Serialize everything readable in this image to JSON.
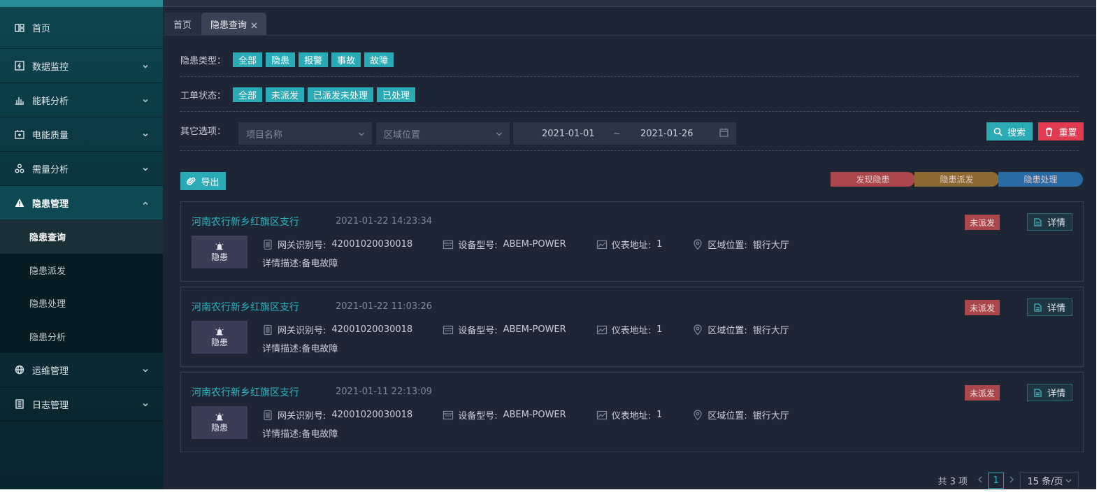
{
  "sidebar": {
    "items": [
      {
        "label": "首页",
        "icon": "dashboard-icon"
      },
      {
        "label": "数据监控",
        "icon": "monitor-icon"
      },
      {
        "label": "能耗分析",
        "icon": "bar-chart-icon"
      },
      {
        "label": "电能质量",
        "icon": "battery-icon"
      },
      {
        "label": "需量分析",
        "icon": "nodes-icon"
      },
      {
        "label": "隐患管理",
        "icon": "warning-icon"
      },
      {
        "label": "运维管理",
        "icon": "globe-icon"
      },
      {
        "label": "日志管理",
        "icon": "log-icon"
      }
    ],
    "submenu": [
      "隐患查询",
      "隐患派发",
      "隐患处理",
      "隐患分析"
    ]
  },
  "tabs": [
    {
      "label": "首页"
    },
    {
      "label": "隐患查询"
    }
  ],
  "filters": {
    "type_label": "隐患类型：",
    "type_options": [
      "全部",
      "隐患",
      "报警",
      "事故",
      "故障"
    ],
    "status_label": "工单状态：",
    "status_options": [
      "全部",
      "未派发",
      "已派发未处理",
      "已处理"
    ],
    "other_label": "其它选项：",
    "project_placeholder": "项目名称",
    "area_placeholder": "区域位置",
    "date_start": "2021-01-01",
    "date_sep": "~",
    "date_end": "2021-01-26"
  },
  "actions": {
    "search": "搜索",
    "reset": "重置",
    "export": "导出"
  },
  "steps": [
    "发现隐患",
    "隐患派发",
    "隐患处理"
  ],
  "step_colors": [
    "#a9474d",
    "#8c6a32",
    "#2a6aa5"
  ],
  "cards": [
    {
      "title": "河南农行新乡红旗区支行",
      "time": "2021-01-22 14:23:34",
      "badge": "未派发",
      "detail": "详情",
      "thumb": "隐患",
      "gateway_label": "网关识别号:",
      "gateway": "42001020030018",
      "model_label": "设备型号:",
      "model": "ABEM-POWER",
      "meter_label": "仪表地址:",
      "meter": "1",
      "area_label": "区域位置:",
      "area": "银行大厅",
      "desc": "详情描述:备电故障"
    },
    {
      "title": "河南农行新乡红旗区支行",
      "time": "2021-01-22 11:03:26",
      "badge": "未派发",
      "detail": "详情",
      "thumb": "隐患",
      "gateway_label": "网关识别号:",
      "gateway": "42001020030018",
      "model_label": "设备型号:",
      "model": "ABEM-POWER",
      "meter_label": "仪表地址:",
      "meter": "1",
      "area_label": "区域位置:",
      "area": "银行大厅",
      "desc": "详情描述:备电故障"
    },
    {
      "title": "河南农行新乡红旗区支行",
      "time": "2021-01-11 22:13:09",
      "badge": "未派发",
      "detail": "详情",
      "thumb": "隐患",
      "gateway_label": "网关识别号:",
      "gateway": "42001020030018",
      "model_label": "设备型号:",
      "model": "ABEM-POWER",
      "meter_label": "仪表地址:",
      "meter": "1",
      "area_label": "区域位置:",
      "area": "银行大厅",
      "desc": "详情描述:备电故障"
    }
  ],
  "pager": {
    "total": "共 3 项",
    "current": "1",
    "size": "15 条/页"
  }
}
